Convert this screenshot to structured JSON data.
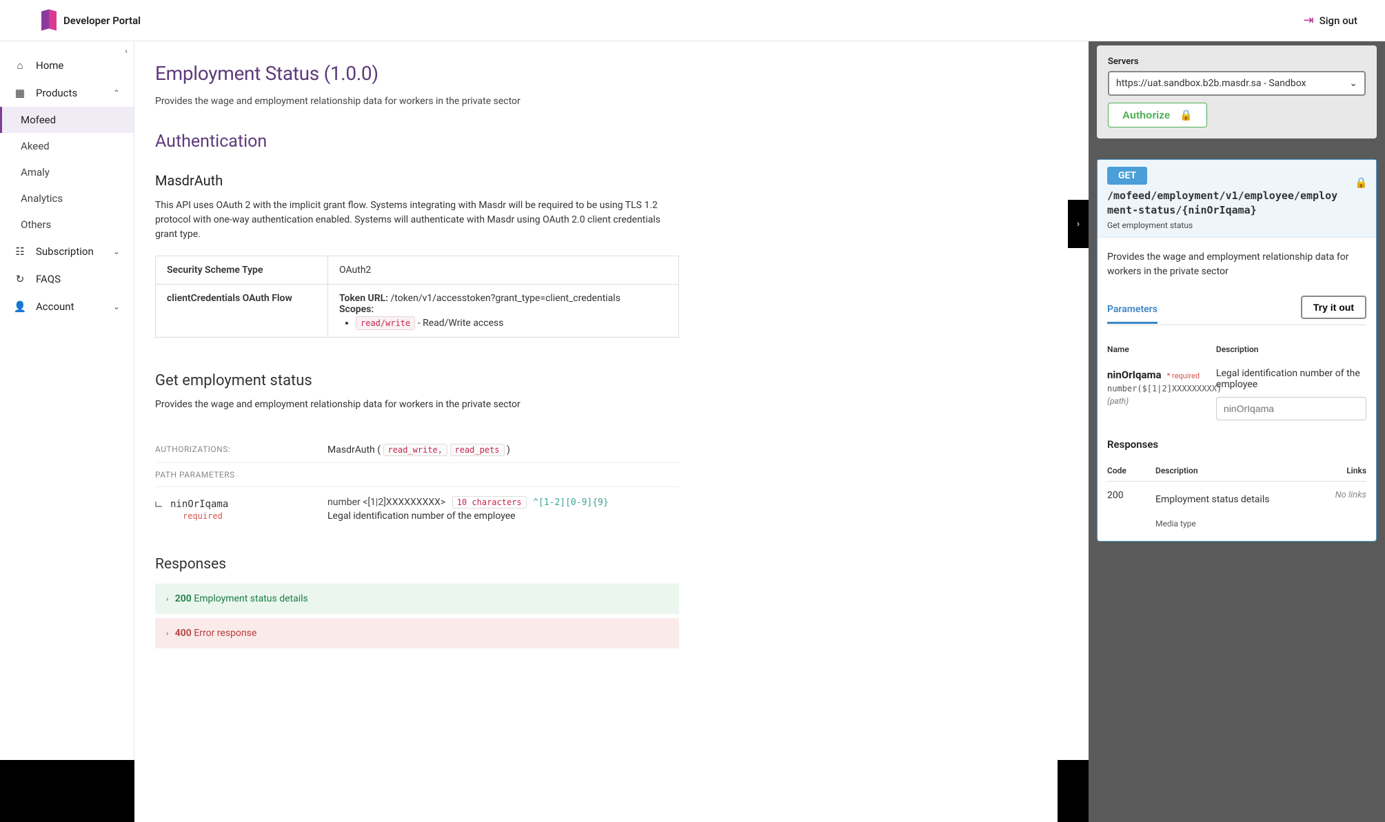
{
  "header": {
    "brand": "Developer Portal",
    "sign_out": "Sign out"
  },
  "sidebar": {
    "items": [
      {
        "label": "Home"
      },
      {
        "label": "Products"
      },
      {
        "label": "Subscription"
      },
      {
        "label": "FAQS"
      },
      {
        "label": "Account"
      }
    ],
    "products_children": [
      {
        "label": "Mofeed"
      },
      {
        "label": "Akeed"
      },
      {
        "label": "Amaly"
      },
      {
        "label": "Analytics"
      },
      {
        "label": "Others"
      }
    ]
  },
  "main": {
    "title": "Employment Status (1.0.0)",
    "description": "Provides the wage and employment relationship data for workers in the private sector",
    "auth_section": "Authentication",
    "auth_scheme": "MasdrAuth",
    "auth_desc": "This API uses OAuth 2 with the implicit grant flow. Systems integrating with Masdr will be required to be using TLS 1.2 protocol with one-way authentication enabled. Systems will authenticate with Masdr using OAuth 2.0 client credentials grant type.",
    "table": {
      "row1_label": "Security Scheme Type",
      "row1_value": "OAuth2",
      "row2_label": "clientCredentials OAuth Flow",
      "token_url_label": "Token URL:",
      "token_url": "/token/v1/accesstoken?grant_type=client_credentials",
      "scopes_label": "Scopes:",
      "scope_code": "read/write",
      "scope_desc": "- Read/Write access"
    },
    "operation": {
      "title": "Get employment status",
      "desc": "Provides the wage and employment relationship data for workers in the private sector",
      "authz_label": "AUTHORIZATIONS:",
      "authz_value": "MasdrAuth",
      "authz_scope1": "read_write,",
      "authz_scope2": "read_pets",
      "path_params_label": "PATH PARAMETERS",
      "param_name": "ninOrIqama",
      "param_req": "required",
      "param_type": "number <[1|2]XXXXXXXXX>",
      "param_len": "10 characters",
      "param_pattern": "^[1-2][0-9]{9}",
      "param_desc": "Legal identification number of the employee"
    },
    "responses_label": "Responses",
    "resp_200_code": "200",
    "resp_200_text": "Employment status details",
    "resp_400_code": "400",
    "resp_400_text": "Error response"
  },
  "right": {
    "servers_label": "Servers",
    "server_value": "https://uat.sandbox.b2b.masdr.sa - Sandbox",
    "authorize": "Authorize",
    "op": {
      "method": "GET",
      "path": "/mofeed/employment/v1/employee/employment-status/{ninOrIqama}",
      "summary": "Get employment status",
      "desc": "Provides the wage and employment relationship data for workers in the private sector",
      "tab_params": "Parameters",
      "try_it": "Try it out",
      "col_name": "Name",
      "col_desc": "Description",
      "p_name": "ninOrIqama",
      "p_req": "* required",
      "p_type": "number($[1|2]XXXXXXXXX)",
      "p_loc": "(path)",
      "p_desc": "Legal identification number of the employee",
      "p_placeholder": "ninOrIqama",
      "resp_label": "Responses",
      "rc_code_h": "Code",
      "rc_desc_h": "Description",
      "rc_links_h": "Links",
      "r200_code": "200",
      "r200_desc": "Employment status details",
      "r200_links": "No links",
      "media_label": "Media type"
    }
  }
}
